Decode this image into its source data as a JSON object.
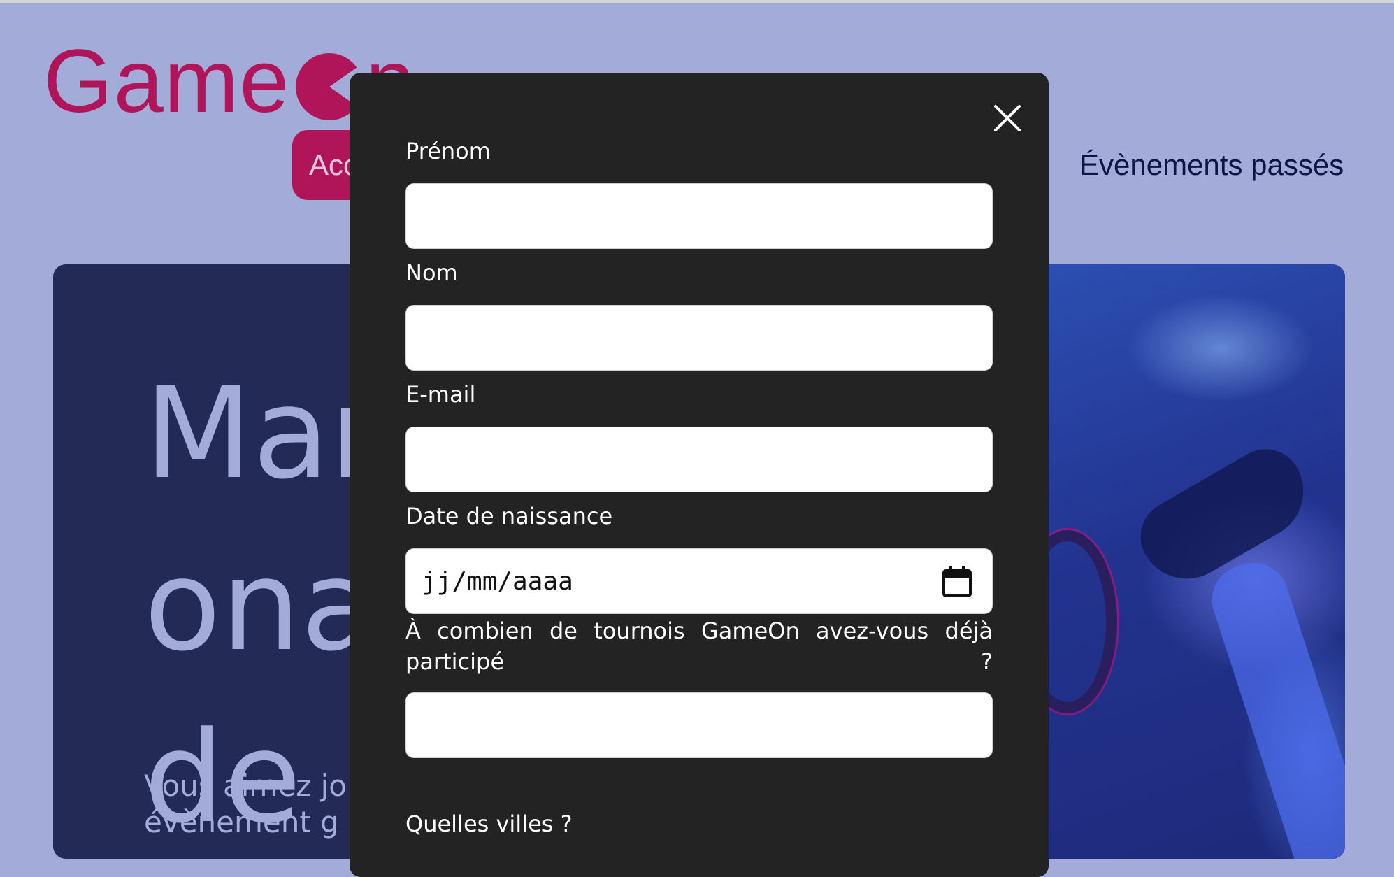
{
  "brand": {
    "logo_text": "GameOn",
    "color": "#b0155a"
  },
  "nav": {
    "active_label": "Acc",
    "past_events_label": "Évènements passés"
  },
  "hero": {
    "title": "Mar                     onal de .",
    "title_visible_fragments": [
      "Mar",
      "onal",
      "de ."
    ],
    "text": "Vous aimez jo",
    "text_line2": "évènement g"
  },
  "modal": {
    "close_icon": "close-icon",
    "fields": {
      "first_name_label": "Prénom",
      "first_name_value": "",
      "last_name_label": "Nom",
      "last_name_value": "",
      "email_label": "E-mail",
      "email_value": "",
      "birthdate_label": "Date de naissance",
      "birthdate_placeholder": "jj/mm/aaaa",
      "birthdate_icon": "calendar-icon",
      "tournaments_label_line1": "À combien de tournois GameOn avez-vous déjà",
      "tournaments_label_line2": "participé ?",
      "tournaments_value": "",
      "cities_label": "Quelles villes ?"
    }
  },
  "colors": {
    "page_bg": "#a3abd9",
    "hero_bg": "#232a56",
    "modal_bg": "#232323",
    "nav_active_bg": "#b0155a",
    "nav_text": "#0e1545"
  }
}
